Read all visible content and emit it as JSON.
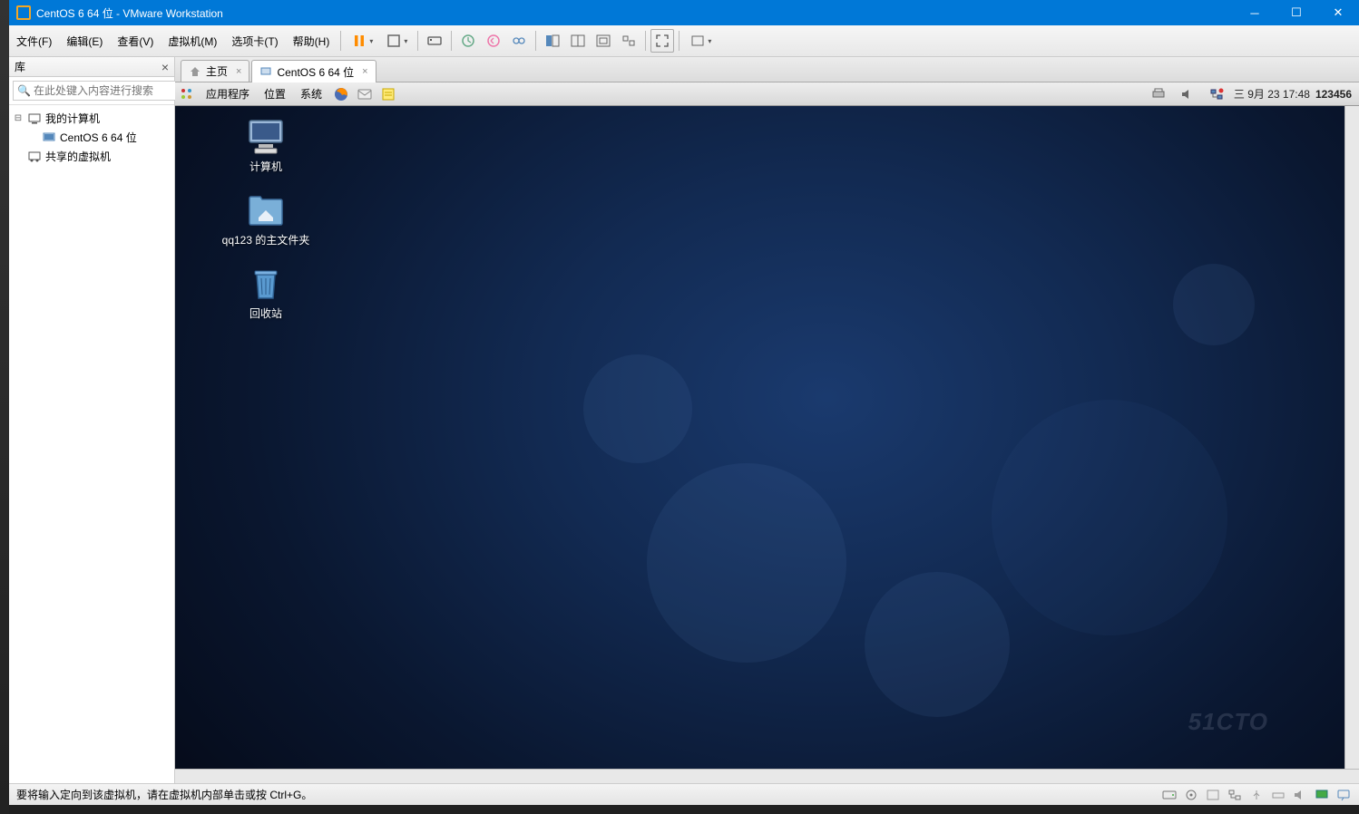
{
  "window": {
    "title": "CentOS 6 64 位 - VMware Workstation"
  },
  "menubar": {
    "file": "文件(F)",
    "edit": "编辑(E)",
    "view": "查看(V)",
    "vm": "虚拟机(M)",
    "tabs": "选项卡(T)",
    "help": "帮助(H)"
  },
  "sidebar": {
    "header": "库",
    "search_placeholder": "在此处键入内容进行搜索",
    "tree": {
      "root": "我的计算机",
      "vm1": "CentOS 6 64 位",
      "shared": "共享的虚拟机"
    }
  },
  "tabs": {
    "home": "主页",
    "vm": "CentOS 6 64 位"
  },
  "guest": {
    "menu": {
      "apps": "应用程序",
      "places": "位置",
      "system": "系统"
    },
    "clock": "三 9月 23 17:48",
    "user": "123456",
    "desktop": {
      "computer": "计算机",
      "home": "qq123 的主文件夹",
      "trash": "回收站"
    }
  },
  "statusbar": {
    "hint": "要将输入定向到该虚拟机，请在虚拟机内部单击或按 Ctrl+G。"
  },
  "watermark": "51CTO"
}
